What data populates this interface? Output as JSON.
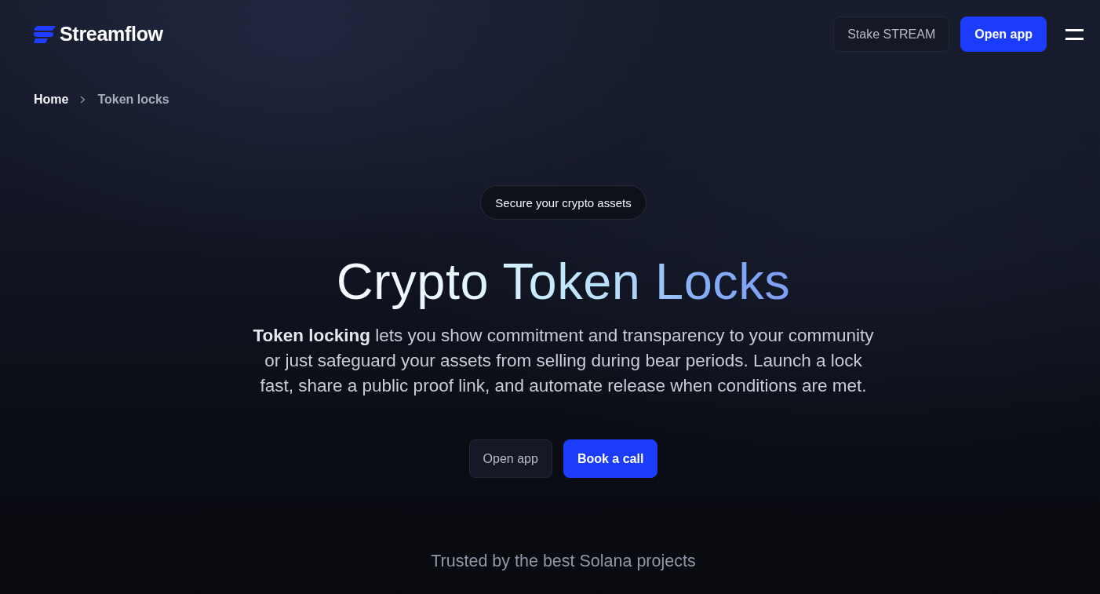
{
  "header": {
    "logo": {
      "text": "Streamflow"
    },
    "buttons": [
      {
        "label": "Stake STREAM",
        "kind": "secondary"
      },
      {
        "label": "Open app",
        "kind": "primary"
      }
    ]
  },
  "breadcrumb": [
    {
      "label": "Home",
      "current": false
    },
    {
      "label": "Token locks",
      "current": true
    }
  ],
  "hero": {
    "badge": "Secure your crypto assets",
    "title": "Crypto Token Locks",
    "description": "**Token locking** lets you show commitment and transparency to your community or just safeguard your assets from selling during bear periods. Launch a lock fast, share a public proof link, and automate release when conditions are met.",
    "buttons": [
      {
        "label": "Open app",
        "kind": "secondary"
      },
      {
        "label": "Book a call",
        "kind": "primary"
      }
    ]
  },
  "trusted": {
    "text": "Trusted by the best Solana projects"
  }
}
